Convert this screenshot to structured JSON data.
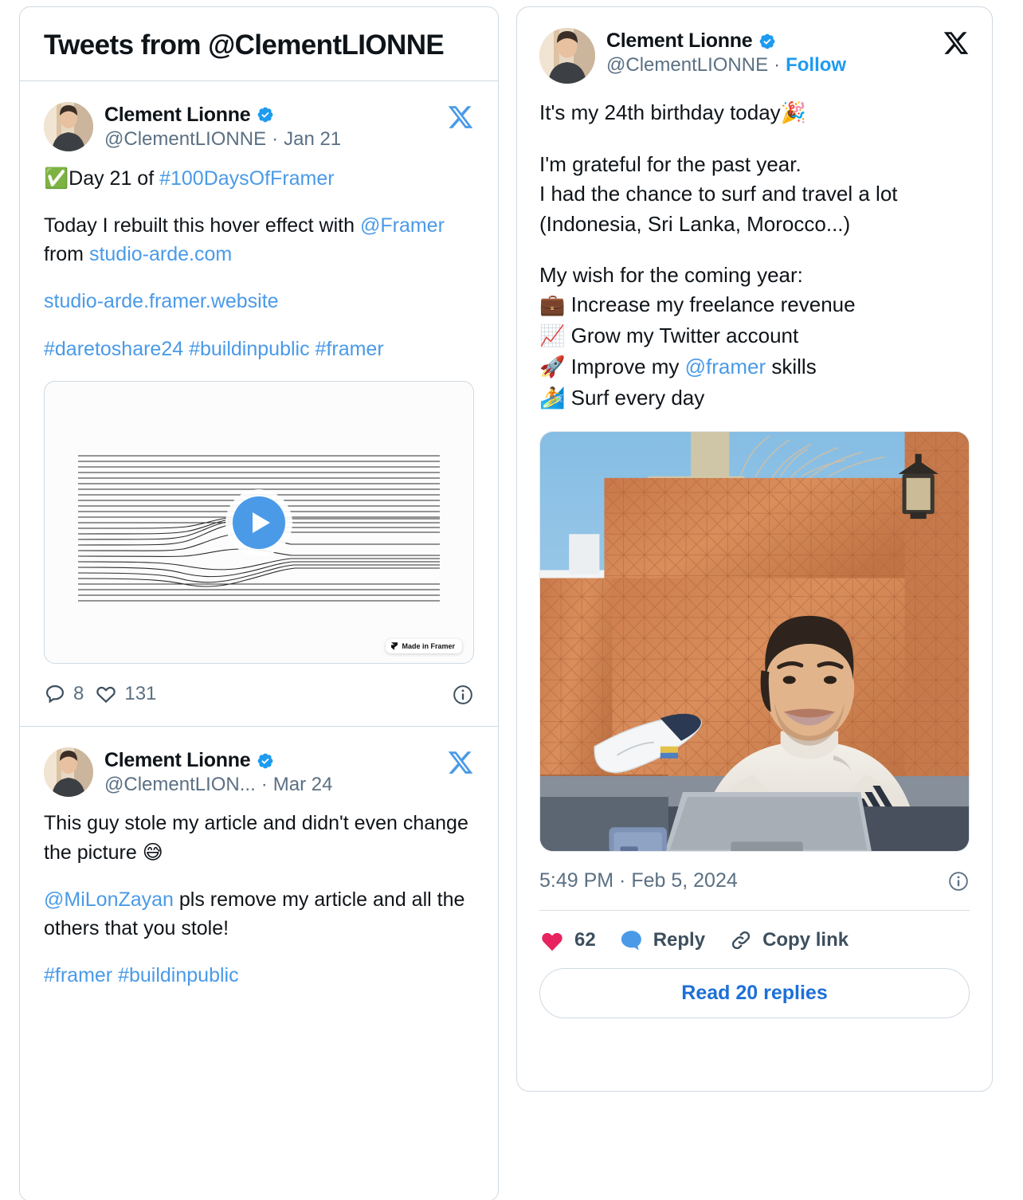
{
  "timeline": {
    "header_title": "Tweets from @ClementLIONNE",
    "tweets": [
      {
        "display_name": "Clement Lionne",
        "handle": "@ClementLIONNE",
        "separator": "·",
        "date": "Jan 21",
        "line1_check": "✅",
        "line1_text": "Day 21 of ",
        "line1_tag": "#100DaysOfFramer",
        "line2_a": "Today I rebuilt this hover effect with ",
        "line2_mention": "@Framer",
        "line2_b": " from ",
        "line2_link": "studio-arde.com",
        "line3_link": "studio-arde.framer.website",
        "line4_tags": "#daretoshare24 #buildinpublic #framer",
        "media": {
          "type": "video",
          "play_label": "Play",
          "badge_text": "Made in Framer"
        },
        "replies_count": "8",
        "likes_count": "131"
      },
      {
        "display_name": "Clement Lionne",
        "handle": "@ClementLION...",
        "separator": "·",
        "date": "Mar 24",
        "line1": "This guy stole my article and didn't even change the picture ",
        "line1_emoji": "😅",
        "line2_mention": "@MiLonZayan",
        "line2_rest": "  pls remove my article and all the others that you stole!",
        "line3_tags": "#framer #buildinpublic"
      }
    ]
  },
  "single_tweet": {
    "display_name": "Clement Lionne",
    "handle": "@ClementLIONNE",
    "separator": "·",
    "follow_label": "Follow",
    "para1_text": "It's my 24th birthday today",
    "para1_emoji": "🎉",
    "para2_line1": "I'm grateful for the past year.",
    "para2_line2": "I had the chance to surf and travel a lot",
    "para2_line3": "(Indonesia, Sri Lanka, Morocco...)",
    "wish_intro": "My wish for the coming year:",
    "wishes": [
      {
        "emoji": "💼",
        "text": "Increase my freelance revenue"
      },
      {
        "emoji": "📈",
        "text": "Grow my Twitter account"
      },
      {
        "emoji": "🚀",
        "text_before": "Improve my ",
        "mention": "@framer",
        "text_after": " skills"
      },
      {
        "emoji": "🏄",
        "text": "Surf every day"
      }
    ],
    "photo_alt": "Man smiling at laptop on terracotta-tiled terrace with surfboard",
    "timestamp": "5:49 PM · Feb 5, 2024",
    "likes_count": "62",
    "reply_label": "Reply",
    "copy_link_label": "Copy link",
    "read_replies_label": "Read 20 replies"
  },
  "icons": {
    "x_logo": "x-logo",
    "verified": "verified-badge",
    "reply": "reply-icon",
    "like": "heart-icon",
    "info": "info-icon",
    "link": "link-icon",
    "play": "play-icon"
  },
  "colors": {
    "link_blue": "#4a9ae8",
    "follow_blue": "#1d9bf0",
    "read_replies_blue": "#1d6fd8",
    "heart_pink": "#e8245f",
    "bubble_blue": "#4a9ae8",
    "muted": "#5b7083",
    "text": "#0f1419",
    "border": "#cfd9e1"
  }
}
